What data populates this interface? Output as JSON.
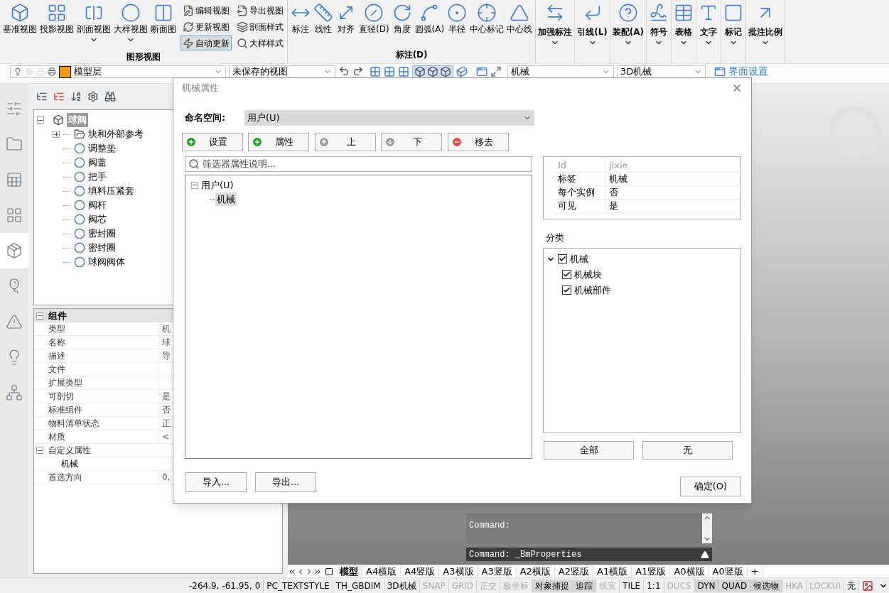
{
  "ribbon": {
    "groups": [
      {
        "title": "图形视图",
        "large": [
          {
            "label": "基准视图",
            "dropdown": false
          },
          {
            "label": "投影视图",
            "dropdown": false
          },
          {
            "label": "剖面视图",
            "dropdown": true
          },
          {
            "label": "大样视图",
            "dropdown": true
          },
          {
            "label": "断面图",
            "dropdown": false
          }
        ],
        "small": [
          {
            "label": "编辑视图",
            "selected": false
          },
          {
            "label": "更新视图",
            "selected": false
          },
          {
            "label": "自动更新",
            "selected": true
          },
          {
            "label": "导出视图",
            "selected": false
          },
          {
            "label": "剖面样式",
            "selected": false
          },
          {
            "label": "大样样式",
            "selected": false
          }
        ]
      },
      {
        "title": "标注(D)",
        "large": [
          {
            "label": "标注",
            "dropdown": false
          },
          {
            "label": "线性",
            "dropdown": false
          },
          {
            "label": "对齐",
            "dropdown": false
          },
          {
            "label": "直径(D)",
            "dropdown": false
          },
          {
            "label": "角度",
            "dropdown": false
          },
          {
            "label": "圆弧(A)",
            "dropdown": false
          },
          {
            "label": "半径",
            "dropdown": false
          },
          {
            "label": "中心标记",
            "dropdown": false
          },
          {
            "label": "中心线",
            "dropdown": false
          }
        ]
      }
    ],
    "tools": [
      {
        "label": "加强标注"
      },
      {
        "label": "引线(L)"
      },
      {
        "label": "装配(A)"
      },
      {
        "label": "符号"
      },
      {
        "label": "表格"
      },
      {
        "label": "文字"
      },
      {
        "label": "标记"
      },
      {
        "label": "批注比例"
      }
    ]
  },
  "toolbar": {
    "layer": {
      "value": "模型层",
      "color": "#ff9900"
    },
    "view": {
      "value": "未保存的视图"
    },
    "standard": {
      "value": "机械"
    },
    "workspace": {
      "value": "3D机械"
    },
    "ui_settings": "界面设置"
  },
  "rail": [
    {
      "selected": false
    },
    {
      "selected": false
    },
    {
      "selected": false
    },
    {
      "selected": false
    },
    {
      "selected": true
    },
    {
      "selected": false
    },
    {
      "selected": false
    },
    {
      "selected": false
    },
    {
      "selected": false
    }
  ],
  "model_tree": {
    "label": "球阀",
    "expanded": true,
    "selected": true,
    "children": [
      {
        "label": "块和外部参考",
        "kind": "folder",
        "expanded": false
      },
      {
        "label": "调整垫",
        "kind": "part"
      },
      {
        "label": "阀盖",
        "kind": "part"
      },
      {
        "label": "把手",
        "kind": "part"
      },
      {
        "label": "填料压紧套",
        "kind": "part"
      },
      {
        "label": "阀杆",
        "kind": "part"
      },
      {
        "label": "阀芯",
        "kind": "part"
      },
      {
        "label": "密封圈",
        "kind": "part"
      },
      {
        "label": "密封圈",
        "kind": "part"
      },
      {
        "label": "球阀阀体",
        "kind": "part"
      }
    ]
  },
  "properties": [
    {
      "kind": "category",
      "label": "组件",
      "expanded": true
    },
    {
      "kind": "row",
      "label": "类型",
      "value": "机"
    },
    {
      "kind": "row",
      "label": "名称",
      "value": "球"
    },
    {
      "kind": "row",
      "label": "描述",
      "value": "导"
    },
    {
      "kind": "row",
      "label": "文件"
    },
    {
      "kind": "row",
      "label": "扩展类型"
    },
    {
      "kind": "row",
      "label": "可剖切",
      "value": "是"
    },
    {
      "kind": "row",
      "label": "标准组件",
      "value": "否"
    },
    {
      "kind": "row",
      "label": "物料清单状态",
      "value": "正"
    },
    {
      "kind": "row",
      "label": "材质",
      "value": "<"
    },
    {
      "kind": "group",
      "label": "自定义属性",
      "expanded": true,
      "children": [
        {
          "label": "机械"
        }
      ]
    },
    {
      "kind": "row",
      "label": "首选方向",
      "value": "0,"
    }
  ],
  "dialog": {
    "title": "机械属性",
    "namespace_label": "命名空间:",
    "namespace": "用户(U)",
    "actions": [
      {
        "label": "设置",
        "kind": "add"
      },
      {
        "label": "属性",
        "kind": "add"
      },
      {
        "label": "上",
        "kind": "up"
      },
      {
        "label": "下",
        "kind": "down"
      },
      {
        "label": "移去",
        "kind": "remove"
      }
    ],
    "search": {
      "placeholder": "筛选器属性说明..."
    },
    "tree": {
      "label": "用户(U)",
      "expanded": true,
      "children": [
        {
          "label": "机械",
          "selected": true
        }
      ]
    },
    "attributes": [
      {
        "name": "Id",
        "value": "jixie",
        "disabled": true
      },
      {
        "name": "标签",
        "value": "机械",
        "disabled": false
      },
      {
        "name": "每个实例",
        "value": "否",
        "disabled": false
      },
      {
        "name": "可见",
        "value": "是",
        "disabled": false
      }
    ],
    "category_label": "分类",
    "categories": {
      "label": "机械",
      "checked": true,
      "expanded": true,
      "children": [
        {
          "label": "机械块",
          "checked": true
        },
        {
          "label": "机械部件",
          "checked": true
        }
      ]
    },
    "select_buttons": [
      "全部",
      "无"
    ],
    "footer_left": [
      "导入...",
      "导出..."
    ],
    "ok": "确定(O)"
  },
  "command": {
    "history": "Command:",
    "current": "Command: _BmProperties"
  },
  "layout_tabs": [
    {
      "label": "模型",
      "selected": true
    },
    {
      "label": "A4横版",
      "selected": false
    },
    {
      "label": "A4竖版",
      "selected": false
    },
    {
      "label": "A3横版",
      "selected": false
    },
    {
      "label": "A3竖版",
      "selected": false
    },
    {
      "label": "A2横版",
      "selected": false
    },
    {
      "label": "A2竖版",
      "selected": false
    },
    {
      "label": "A1横版",
      "selected": false
    },
    {
      "label": "A1竖版",
      "selected": false
    },
    {
      "label": "A0横版",
      "selected": false
    },
    {
      "label": "A0竖版",
      "selected": false
    },
    {
      "label": "+",
      "selected": false
    }
  ],
  "status_bar": [
    {
      "label": "-264.9, -61.95, 0",
      "kind": "text"
    },
    {
      "label": "PC_TEXTSTYLE",
      "kind": "text"
    },
    {
      "label": "TH_GBDIM",
      "kind": "text"
    },
    {
      "label": "3D机械",
      "kind": "text"
    },
    {
      "label": "SNAP",
      "kind": "toggle",
      "on": false
    },
    {
      "label": "GRID",
      "kind": "toggle",
      "on": false
    },
    {
      "label": "正交",
      "kind": "toggle",
      "on": false
    },
    {
      "label": "极坐标",
      "kind": "toggle",
      "on": false
    },
    {
      "label": "对象捕捉",
      "kind": "toggle",
      "on": true
    },
    {
      "label": "追踪",
      "kind": "toggle",
      "on": true
    },
    {
      "label": "线宽",
      "kind": "toggle",
      "on": false
    },
    {
      "label": "TILE",
      "kind": "text"
    },
    {
      "label": "1:1",
      "kind": "text"
    },
    {
      "label": "DUCS",
      "kind": "toggle",
      "on": false
    },
    {
      "label": "DYN",
      "kind": "toggle",
      "on": true
    },
    {
      "label": "QUAD",
      "kind": "toggle",
      "on": true
    },
    {
      "label": "候选物",
      "kind": "toggle",
      "on": true
    },
    {
      "label": "HKA",
      "kind": "toggle",
      "on": false
    },
    {
      "label": "LOCKUI",
      "kind": "toggle",
      "on": false
    },
    {
      "label": "无",
      "kind": "text"
    }
  ]
}
